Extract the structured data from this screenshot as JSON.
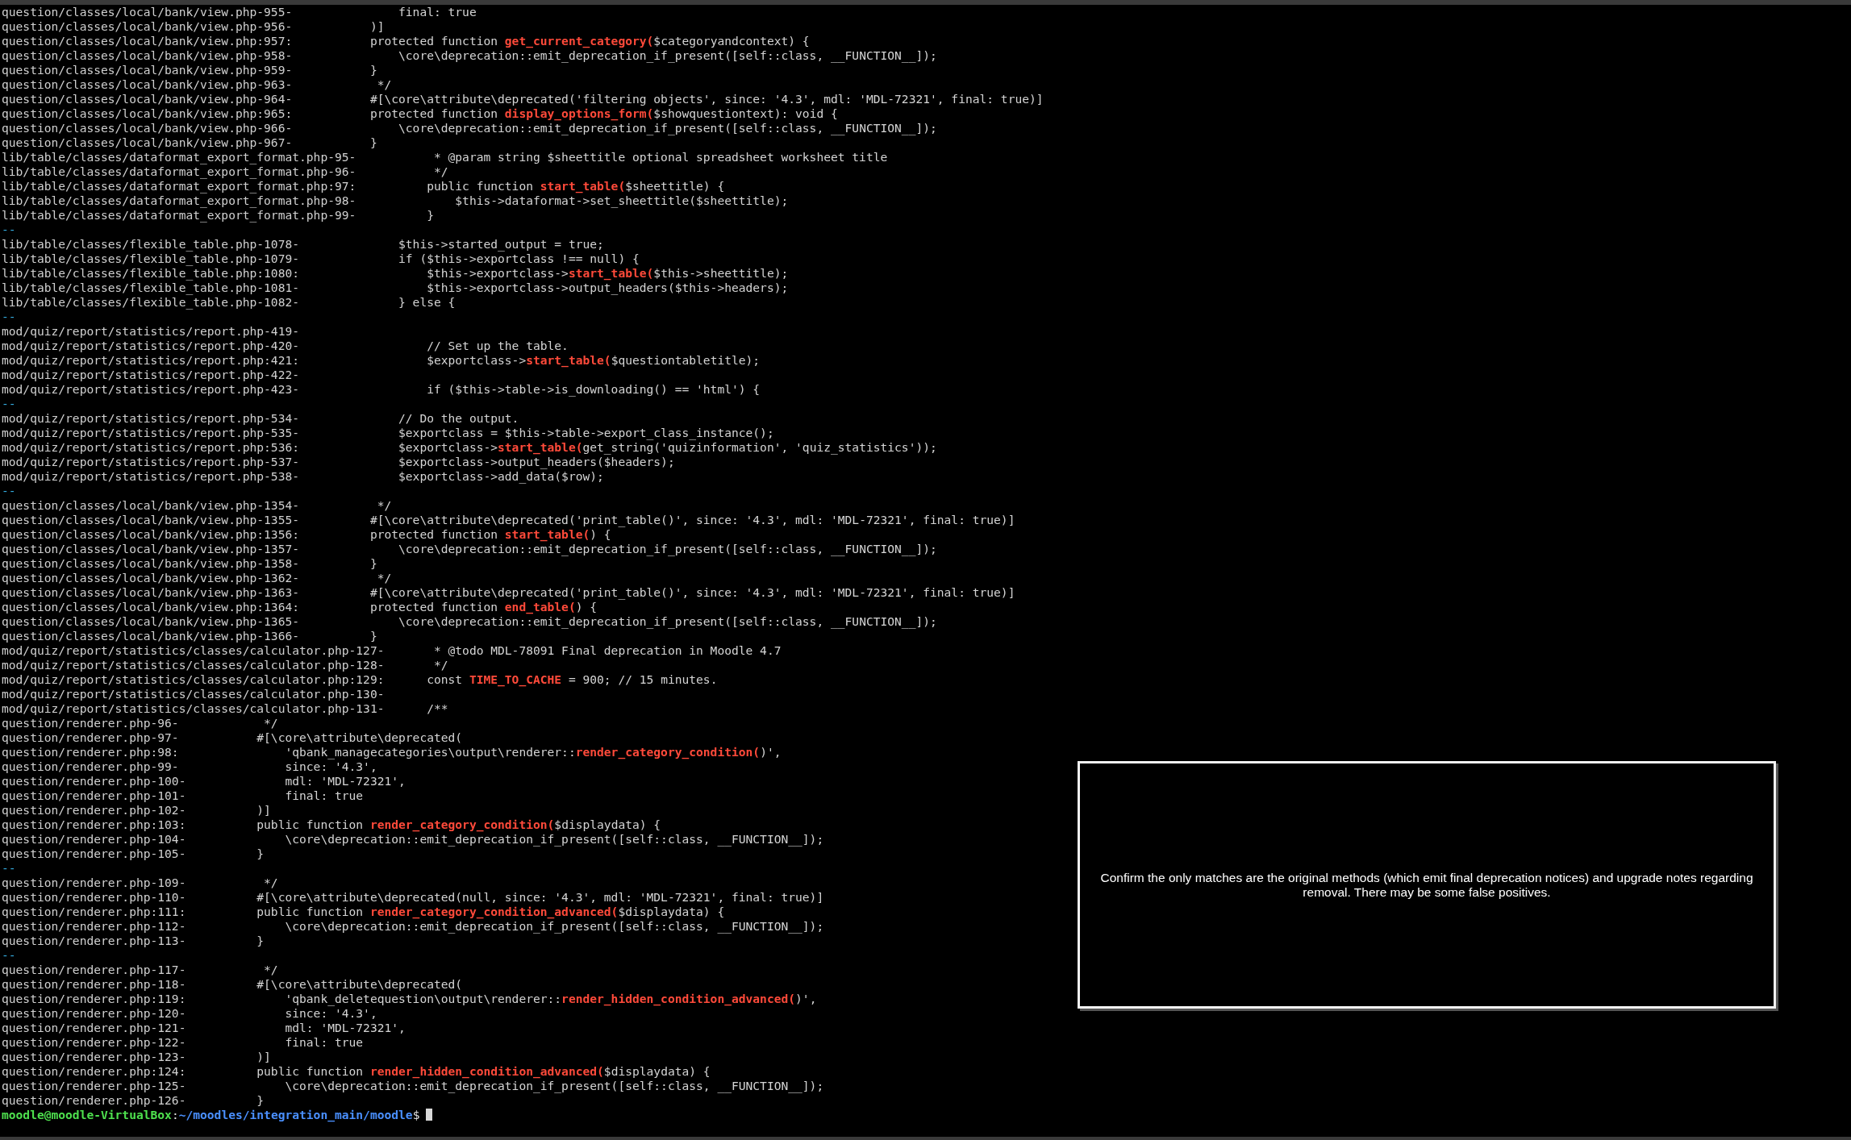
{
  "terminal": {
    "lines": [
      {
        "kind": "context",
        "location": "question/classes/local/bank/view.php-955-",
        "code": "        final: true"
      },
      {
        "kind": "context",
        "location": "question/classes/local/bank/view.php-956-",
        "code": "    )]"
      },
      {
        "kind": "match",
        "location": "question/classes/local/bank/view.php:957:",
        "code": "    protected function **get_current_category(**$categoryandcontext) {"
      },
      {
        "kind": "context",
        "location": "question/classes/local/bank/view.php-958-",
        "code": "        \\core\\deprecation::emit_deprecation_if_present([self::class, __FUNCTION__]);"
      },
      {
        "kind": "context",
        "location": "question/classes/local/bank/view.php-959-",
        "code": "    }"
      },
      {
        "kind": "context",
        "location": "question/classes/local/bank/view.php-963-",
        "code": "     */"
      },
      {
        "kind": "context",
        "location": "question/classes/local/bank/view.php-964-",
        "code": "    #[\\core\\attribute\\deprecated('filtering objects', since: '4.3', mdl: 'MDL-72321', final: true)]"
      },
      {
        "kind": "match",
        "location": "question/classes/local/bank/view.php:965:",
        "code": "    protected function **display_options_form(**$showquestiontext): void {"
      },
      {
        "kind": "context",
        "location": "question/classes/local/bank/view.php-966-",
        "code": "        \\core\\deprecation::emit_deprecation_if_present([self::class, __FUNCTION__]);"
      },
      {
        "kind": "context",
        "location": "question/classes/local/bank/view.php-967-",
        "code": "    }"
      },
      {
        "kind": "context",
        "location": "lib/table/classes/dataformat_export_format.php-95-",
        "code": "     * @param string $sheettitle optional spreadsheet worksheet title"
      },
      {
        "kind": "context",
        "location": "lib/table/classes/dataformat_export_format.php-96-",
        "code": "     */"
      },
      {
        "kind": "match",
        "location": "lib/table/classes/dataformat_export_format.php:97:",
        "code": "    public function **start_table(**$sheettitle) {"
      },
      {
        "kind": "context",
        "location": "lib/table/classes/dataformat_export_format.php-98-",
        "code": "        $this->dataformat->set_sheettitle($sheettitle);"
      },
      {
        "kind": "context",
        "location": "lib/table/classes/dataformat_export_format.php-99-",
        "code": "    }"
      },
      {
        "kind": "separator",
        "text": "--"
      },
      {
        "kind": "context",
        "location": "lib/table/classes/flexible_table.php-1078-",
        "code": "        $this->started_output = true;"
      },
      {
        "kind": "context",
        "location": "lib/table/classes/flexible_table.php-1079-",
        "code": "        if ($this->exportclass !== null) {"
      },
      {
        "kind": "match",
        "location": "lib/table/classes/flexible_table.php:1080:",
        "code": "            $this->exportclass->**start_table(**$this->sheettitle);"
      },
      {
        "kind": "context",
        "location": "lib/table/classes/flexible_table.php-1081-",
        "code": "            $this->exportclass->output_headers($this->headers);"
      },
      {
        "kind": "context",
        "location": "lib/table/classes/flexible_table.php-1082-",
        "code": "        } else {"
      },
      {
        "kind": "separator",
        "text": "--"
      },
      {
        "kind": "context",
        "location": "mod/quiz/report/statistics/report.php-419-"
      },
      {
        "kind": "context",
        "location": "mod/quiz/report/statistics/report.php-420-",
        "code": "            // Set up the table."
      },
      {
        "kind": "match",
        "location": "mod/quiz/report/statistics/report.php:421:",
        "code": "            $exportclass->**start_table(**$questiontabletitle);"
      },
      {
        "kind": "context",
        "location": "mod/quiz/report/statistics/report.php-422-"
      },
      {
        "kind": "context",
        "location": "mod/quiz/report/statistics/report.php-423-",
        "code": "            if ($this->table->is_downloading() == 'html') {"
      },
      {
        "kind": "separator",
        "text": "--"
      },
      {
        "kind": "context",
        "location": "mod/quiz/report/statistics/report.php-534-",
        "code": "        // Do the output."
      },
      {
        "kind": "context",
        "location": "mod/quiz/report/statistics/report.php-535-",
        "code": "        $exportclass = $this->table->export_class_instance();"
      },
      {
        "kind": "match",
        "location": "mod/quiz/report/statistics/report.php:536:",
        "code": "        $exportclass->**start_table(**get_string('quizinformation', 'quiz_statistics'));"
      },
      {
        "kind": "context",
        "location": "mod/quiz/report/statistics/report.php-537-",
        "code": "        $exportclass->output_headers($headers);"
      },
      {
        "kind": "context",
        "location": "mod/quiz/report/statistics/report.php-538-",
        "code": "        $exportclass->add_data($row);"
      },
      {
        "kind": "separator",
        "text": "--"
      },
      {
        "kind": "context",
        "location": "question/classes/local/bank/view.php-1354-",
        "code": "     */"
      },
      {
        "kind": "context",
        "location": "question/classes/local/bank/view.php-1355-",
        "code": "    #[\\core\\attribute\\deprecated('print_table()', since: '4.3', mdl: 'MDL-72321', final: true)]"
      },
      {
        "kind": "match",
        "location": "question/classes/local/bank/view.php:1356:",
        "code": "    protected function **start_table(**) {"
      },
      {
        "kind": "context",
        "location": "question/classes/local/bank/view.php-1357-",
        "code": "        \\core\\deprecation::emit_deprecation_if_present([self::class, __FUNCTION__]);"
      },
      {
        "kind": "context",
        "location": "question/classes/local/bank/view.php-1358-",
        "code": "    }"
      },
      {
        "kind": "context",
        "location": "question/classes/local/bank/view.php-1362-",
        "code": "     */"
      },
      {
        "kind": "context",
        "location": "question/classes/local/bank/view.php-1363-",
        "code": "    #[\\core\\attribute\\deprecated('print_table()', since: '4.3', mdl: 'MDL-72321', final: true)]"
      },
      {
        "kind": "match",
        "location": "question/classes/local/bank/view.php:1364:",
        "code": "    protected function **end_table(**) {"
      },
      {
        "kind": "context",
        "location": "question/classes/local/bank/view.php-1365-",
        "code": "        \\core\\deprecation::emit_deprecation_if_present([self::class, __FUNCTION__]);"
      },
      {
        "kind": "context",
        "location": "question/classes/local/bank/view.php-1366-",
        "code": "    }"
      },
      {
        "kind": "context",
        "location": "mod/quiz/report/statistics/classes/calculator.php-127-",
        "code": "     * @todo MDL-78091 Final deprecation in Moodle 4.7"
      },
      {
        "kind": "context",
        "location": "mod/quiz/report/statistics/classes/calculator.php-128-",
        "code": "     */"
      },
      {
        "kind": "match",
        "location": "mod/quiz/report/statistics/classes/calculator.php:129:",
        "code": "    const **TIME_TO_CACHE** = 900; // 15 minutes."
      },
      {
        "kind": "context",
        "location": "mod/quiz/report/statistics/classes/calculator.php-130-"
      },
      {
        "kind": "context",
        "location": "mod/quiz/report/statistics/classes/calculator.php-131-",
        "code": "    /**"
      },
      {
        "kind": "context",
        "location": "question/renderer.php-96-",
        "code": "     */"
      },
      {
        "kind": "context",
        "location": "question/renderer.php-97-",
        "code": "    #[\\core\\attribute\\deprecated("
      },
      {
        "kind": "match",
        "location": "question/renderer.php:98:",
        "code": "        'qbank_managecategories\\output\\renderer::**render_category_condition(**)',"
      },
      {
        "kind": "context",
        "location": "question/renderer.php-99-",
        "code": "        since: '4.3',"
      },
      {
        "kind": "context",
        "location": "question/renderer.php-100-",
        "code": "        mdl: 'MDL-72321',"
      },
      {
        "kind": "context",
        "location": "question/renderer.php-101-",
        "code": "        final: true"
      },
      {
        "kind": "context",
        "location": "question/renderer.php-102-",
        "code": "    )]"
      },
      {
        "kind": "match",
        "location": "question/renderer.php:103:",
        "code": "    public function **render_category_condition(**$displaydata) {"
      },
      {
        "kind": "context",
        "location": "question/renderer.php-104-",
        "code": "        \\core\\deprecation::emit_deprecation_if_present([self::class, __FUNCTION__]);"
      },
      {
        "kind": "context",
        "location": "question/renderer.php-105-",
        "code": "    }"
      },
      {
        "kind": "separator",
        "text": "--"
      },
      {
        "kind": "context",
        "location": "question/renderer.php-109-",
        "code": "     */"
      },
      {
        "kind": "context",
        "location": "question/renderer.php-110-",
        "code": "    #[\\core\\attribute\\deprecated(null, since: '4.3', mdl: 'MDL-72321', final: true)]"
      },
      {
        "kind": "match",
        "location": "question/renderer.php:111:",
        "code": "    public function **render_category_condition_advanced(**$displaydata) {"
      },
      {
        "kind": "context",
        "location": "question/renderer.php-112-",
        "code": "        \\core\\deprecation::emit_deprecation_if_present([self::class, __FUNCTION__]);"
      },
      {
        "kind": "context",
        "location": "question/renderer.php-113-",
        "code": "    }"
      },
      {
        "kind": "separator",
        "text": "--"
      },
      {
        "kind": "context",
        "location": "question/renderer.php-117-",
        "code": "     */"
      },
      {
        "kind": "context",
        "location": "question/renderer.php-118-",
        "code": "    #[\\core\\attribute\\deprecated("
      },
      {
        "kind": "match",
        "location": "question/renderer.php:119:",
        "code": "        'qbank_deletequestion\\output\\renderer::**render_hidden_condition_advanced(**)',"
      },
      {
        "kind": "context",
        "location": "question/renderer.php-120-",
        "code": "        since: '4.3',"
      },
      {
        "kind": "context",
        "location": "question/renderer.php-121-",
        "code": "        mdl: 'MDL-72321',"
      },
      {
        "kind": "context",
        "location": "question/renderer.php-122-",
        "code": "        final: true"
      },
      {
        "kind": "context",
        "location": "question/renderer.php-123-",
        "code": "    )]"
      },
      {
        "kind": "match",
        "location": "question/renderer.php:124:",
        "code": "    public function **render_hidden_condition_advanced(**$displaydata) {"
      },
      {
        "kind": "context",
        "location": "question/renderer.php-125-",
        "code": "        \\core\\deprecation::emit_deprecation_if_present([self::class, __FUNCTION__]);"
      },
      {
        "kind": "context",
        "location": "question/renderer.php-126-",
        "code": "    }"
      }
    ],
    "prompt": {
      "user_host": "moodle@moodle-VirtualBox",
      "separator": ":",
      "path": "~/moodles/integration_main/moodle",
      "symbol": "$"
    }
  },
  "overlay": {
    "message": "Confirm the only matches are the original methods (which emit final deprecation notices) and upgrade notes regarding removal. There may be some false positives."
  }
}
